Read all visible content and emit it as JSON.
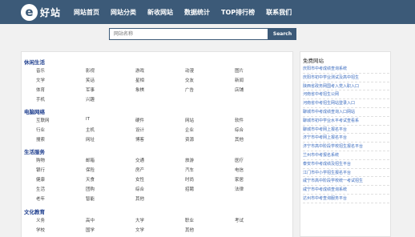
{
  "header": {
    "logo_letter": "e",
    "logo_text": "好站",
    "nav": [
      "网站首页",
      "网站分类",
      "新收网站",
      "数据统计",
      "TOP排行榜",
      "联系我们"
    ]
  },
  "search": {
    "placeholder": "网站名称",
    "button": "Search"
  },
  "categories": [
    {
      "title": "休闲生活",
      "rows": [
        [
          "音乐",
          "影视",
          "游戏",
          "动漫",
          "图片"
        ],
        [
          "文学",
          "笑话",
          "星相",
          "交友",
          "新闻"
        ],
        [
          "体育",
          "军事",
          "象棋",
          "广告",
          "店铺"
        ],
        [
          "手机",
          "兴趣"
        ]
      ]
    },
    {
      "title": "电脑网络",
      "rows": [
        [
          "互联网",
          "IT",
          "硬件",
          "网站",
          "软件"
        ],
        [
          "行业",
          "主机",
          "设计",
          "企业",
          "综合"
        ],
        [
          "搜索",
          "网址",
          "博客",
          "资源",
          "其他"
        ]
      ]
    },
    {
      "title": "生活服务",
      "rows": [
        [
          "购物",
          "邮箱",
          "交通",
          "旅游",
          "医疗"
        ],
        [
          "银行",
          "保险",
          "房产",
          "汽车",
          "电信"
        ],
        [
          "健康",
          "天食",
          "女性",
          "时尚",
          "家居"
        ],
        [
          "生活",
          "团购",
          "综合",
          "招聘",
          "法律"
        ],
        [
          "老年",
          "智能",
          "其他"
        ]
      ]
    },
    {
      "title": "文化教育",
      "rows": [
        [
          "义务",
          "高中",
          "大学",
          "职业",
          "考试"
        ],
        [
          "学校",
          "国学",
          "文学",
          "其他"
        ]
      ]
    }
  ],
  "sidebar": {
    "title": "免费网站",
    "items": [
      "庆阳市中考成绩查询系统",
      "庆阳市初中学业测试及高中招生",
      "陕西省政务网国考入党入职入口",
      "河南省中考招生公网",
      "河南省中考招生网站登录入口",
      "聊城市中考成绩查询入口网站",
      "聊城市初中学业水平考试查看系",
      "聊城市中考网上报名平台",
      "济宁市中考网上报名平台",
      "济宁市高中阶段学校招生报名平台",
      "兰州市中考报名系统",
      "泰安市中考成绩及招生平台",
      "江门市中小学招生报名平台",
      "咸宁市高中阶段学校统一考试招生",
      "咸宁市中考成绩查询系统",
      "达州市中考查询服务平台"
    ]
  }
}
